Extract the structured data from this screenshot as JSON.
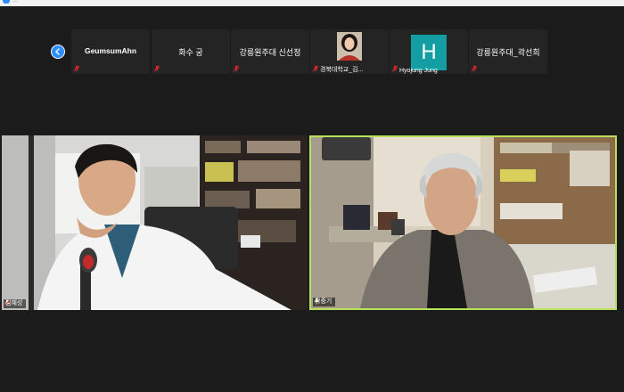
{
  "window": {
    "title_fragment": "..."
  },
  "participants_strip": {
    "nav_label": "",
    "tiles": [
      {
        "name": "GeumsumAhn",
        "label": "",
        "kind": "name"
      },
      {
        "name": "화수 궁",
        "label": "",
        "kind": "name"
      },
      {
        "name": "강릉원주대 신선정",
        "label": "",
        "kind": "name"
      },
      {
        "name": "",
        "label": "경북대학교_김...",
        "kind": "photo"
      },
      {
        "name": "",
        "label": "Hyojung Jung",
        "kind": "letter",
        "letter": "H"
      },
      {
        "name": "강릉원주대_곽선희",
        "label": "",
        "kind": "name"
      }
    ]
  },
  "videos": {
    "left": {
      "name": "김혜성"
    },
    "right": {
      "name": "곽중기"
    }
  },
  "colors": {
    "background": "#1b1b1b",
    "tile_bg": "#242424",
    "accent": "#2d8cff",
    "active_speaker": "#b8e05a",
    "avatar_h": "#139ea3",
    "muted_icon": "#e02828"
  },
  "icons": {
    "nav": "chevron-left-icon",
    "muted": "mic-off-icon"
  }
}
